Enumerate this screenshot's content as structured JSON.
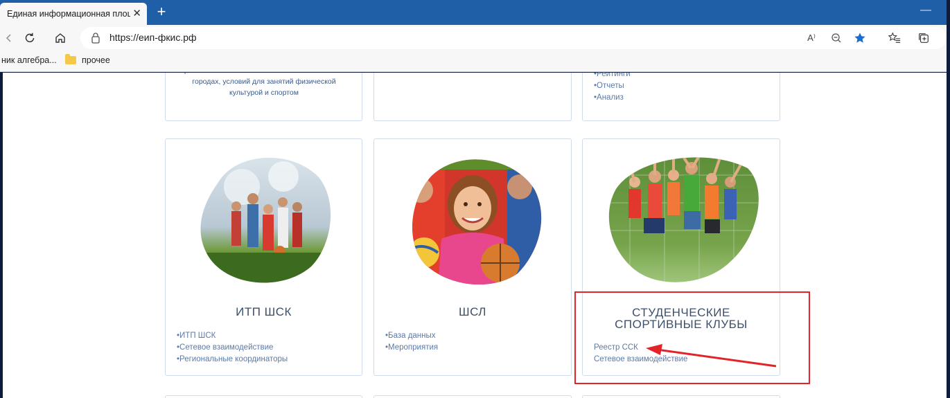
{
  "browser": {
    "tab_title": "Единая информационная площ",
    "tab_close": "✕",
    "new_tab": "+",
    "url": "https://еип-фкис.рф",
    "read_aloud": "A⁾"
  },
  "bookmarks": [
    {
      "label": "ник алгебра..."
    },
    {
      "label": "прочее"
    }
  ],
  "top_cards": {
    "left_text": "расположенных в сельской местности и малых городах, условий для занятий физической культурой и спортом",
    "right_links": [
      "•Рейтинги",
      "•Отчеты",
      "•Анализ"
    ]
  },
  "cards": [
    {
      "title": "ИТП ШСК",
      "links": [
        "•ИТП ШСК",
        "•Сетевое взаимодействие",
        "•Региональные координаторы"
      ]
    },
    {
      "title": "ШСЛ",
      "links": [
        "•База данных",
        "•Мероприятия"
      ]
    },
    {
      "title_line1": "СТУДЕНЧЕСКИЕ",
      "title_line2": "СПОРТИВНЫЕ КЛУБЫ",
      "links": [
        "Реестр ССК",
        "Сетевое взаимодействие"
      ]
    }
  ],
  "colors": {
    "highlight": "#e2232a",
    "link": "#5b7aa8",
    "title": "#3c4f6b"
  }
}
